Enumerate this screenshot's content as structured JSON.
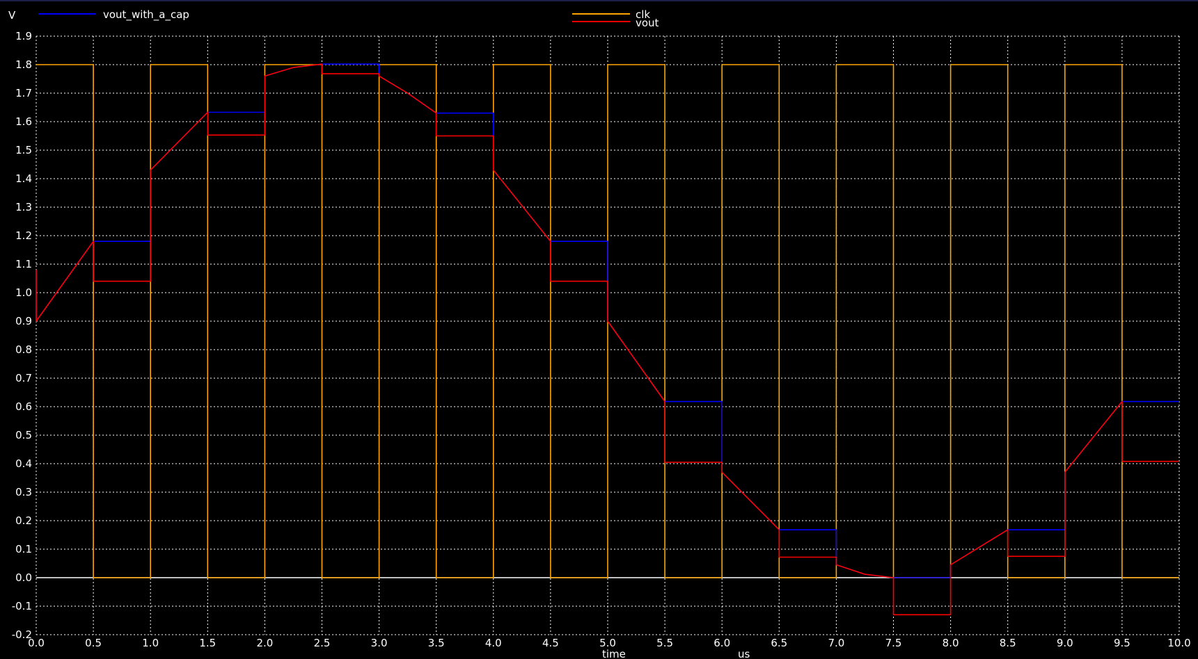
{
  "chart_data": {
    "type": "line",
    "ylabel": "V",
    "xlabel": "time",
    "xunit": "us",
    "xlim": [
      0.0,
      10.0
    ],
    "ylim": [
      -0.2,
      1.9
    ],
    "grid": true,
    "x_ticks": [
      "0.0",
      "0.5",
      "1.0",
      "1.5",
      "2.0",
      "2.5",
      "3.0",
      "3.5",
      "4.0",
      "4.5",
      "5.0",
      "5.5",
      "6.0",
      "6.5",
      "7.0",
      "7.5",
      "8.0",
      "8.5",
      "9.0",
      "9.5",
      "10.0"
    ],
    "y_ticks": [
      "1.9",
      "1.8",
      "1.7",
      "1.6",
      "1.5",
      "1.4",
      "1.3",
      "1.2",
      "1.1",
      "1.0",
      "0.9",
      "0.8",
      "0.7",
      "0.6",
      "0.5",
      "0.4",
      "0.3",
      "0.2",
      "0.1",
      "0.0",
      "-0.1",
      "-0.2"
    ],
    "legend": [
      {
        "name": "vout_with_a_cap",
        "color": "#0000ff"
      },
      {
        "name": "clk",
        "color": "#ffa500"
      },
      {
        "name": "vout",
        "color": "#ff0000"
      }
    ],
    "series": [
      {
        "name": "clk",
        "color": "#ffa500",
        "points": [
          [
            0,
            1.8
          ],
          [
            0.5,
            1.8
          ],
          [
            0.5,
            0
          ],
          [
            1.0,
            0
          ],
          [
            1.0,
            1.8
          ],
          [
            1.5,
            1.8
          ],
          [
            1.5,
            0
          ],
          [
            2.0,
            0
          ],
          [
            2.0,
            1.8
          ],
          [
            2.5,
            1.8
          ],
          [
            2.5,
            0
          ],
          [
            3.0,
            0
          ],
          [
            3.0,
            1.8
          ],
          [
            3.5,
            1.8
          ],
          [
            3.5,
            0
          ],
          [
            4.0,
            0
          ],
          [
            4.0,
            1.8
          ],
          [
            4.5,
            1.8
          ],
          [
            4.5,
            0
          ],
          [
            5.0,
            0
          ],
          [
            5.0,
            1.8
          ],
          [
            5.5,
            1.8
          ],
          [
            5.5,
            0
          ],
          [
            6.0,
            0
          ],
          [
            6.0,
            1.8
          ],
          [
            6.5,
            1.8
          ],
          [
            6.5,
            0
          ],
          [
            7.0,
            0
          ],
          [
            7.0,
            1.8
          ],
          [
            7.5,
            1.8
          ],
          [
            7.5,
            0
          ],
          [
            8.0,
            0
          ],
          [
            8.0,
            1.8
          ],
          [
            8.5,
            1.8
          ],
          [
            8.5,
            0
          ],
          [
            9.0,
            0
          ],
          [
            9.0,
            1.8
          ],
          [
            9.5,
            1.8
          ],
          [
            9.5,
            0
          ],
          [
            10.0,
            0
          ]
        ]
      },
      {
        "name": "vout_with_a_cap",
        "color": "#0000ff",
        "points": [
          [
            0,
            1.08
          ],
          [
            0,
            0.9
          ],
          [
            0.5,
            1.18
          ],
          [
            1.0,
            1.18
          ],
          [
            1.0,
            1.43
          ],
          [
            1.5,
            1.633
          ],
          [
            2.0,
            1.633
          ],
          [
            2.0,
            1.76
          ],
          [
            2.25,
            1.79
          ],
          [
            2.5,
            1.802
          ],
          [
            3.0,
            1.802
          ],
          [
            3.0,
            1.76
          ],
          [
            3.25,
            1.7
          ],
          [
            3.5,
            1.63
          ],
          [
            4.0,
            1.63
          ],
          [
            4.0,
            1.43
          ],
          [
            4.5,
            1.18
          ],
          [
            5.0,
            1.18
          ],
          [
            5.0,
            0.9
          ],
          [
            5.5,
            0.618
          ],
          [
            6.0,
            0.618
          ],
          [
            6.0,
            0.37
          ],
          [
            6.5,
            0.168
          ],
          [
            7.0,
            0.168
          ],
          [
            7.0,
            0.045
          ],
          [
            7.25,
            0.012
          ],
          [
            7.5,
            0.0
          ],
          [
            8.0,
            0.0
          ],
          [
            8.0,
            0.045
          ],
          [
            8.5,
            0.168
          ],
          [
            9.0,
            0.168
          ],
          [
            9.0,
            0.37
          ],
          [
            9.5,
            0.618
          ],
          [
            10.0,
            0.618
          ]
        ]
      },
      {
        "name": "vout",
        "color": "#ff0000",
        "points": [
          [
            0,
            1.08
          ],
          [
            0,
            0.9
          ],
          [
            0.5,
            1.18
          ],
          [
            0.5,
            1.04
          ],
          [
            1.0,
            1.04
          ],
          [
            1.0,
            1.43
          ],
          [
            1.5,
            1.633
          ],
          [
            1.5,
            1.553
          ],
          [
            2.0,
            1.553
          ],
          [
            2.0,
            1.76
          ],
          [
            2.25,
            1.79
          ],
          [
            2.5,
            1.802
          ],
          [
            2.5,
            1.768
          ],
          [
            3.0,
            1.768
          ],
          [
            3.0,
            1.76
          ],
          [
            3.25,
            1.7
          ],
          [
            3.5,
            1.63
          ],
          [
            3.5,
            1.55
          ],
          [
            4.0,
            1.55
          ],
          [
            4.0,
            1.43
          ],
          [
            4.5,
            1.18
          ],
          [
            4.5,
            1.04
          ],
          [
            5.0,
            1.04
          ],
          [
            5.0,
            0.9
          ],
          [
            5.5,
            0.618
          ],
          [
            5.5,
            0.405
          ],
          [
            6.0,
            0.405
          ],
          [
            6.0,
            0.37
          ],
          [
            6.5,
            0.168
          ],
          [
            6.5,
            0.072
          ],
          [
            7.0,
            0.072
          ],
          [
            7.0,
            0.045
          ],
          [
            7.25,
            0.012
          ],
          [
            7.5,
            0.0
          ],
          [
            7.5,
            -0.13
          ],
          [
            8.0,
            -0.13
          ],
          [
            8.0,
            0.045
          ],
          [
            8.5,
            0.168
          ],
          [
            8.5,
            0.075
          ],
          [
            9.0,
            0.075
          ],
          [
            9.0,
            0.37
          ],
          [
            9.5,
            0.618
          ],
          [
            9.5,
            0.408
          ],
          [
            10.0,
            0.408
          ]
        ]
      }
    ]
  }
}
